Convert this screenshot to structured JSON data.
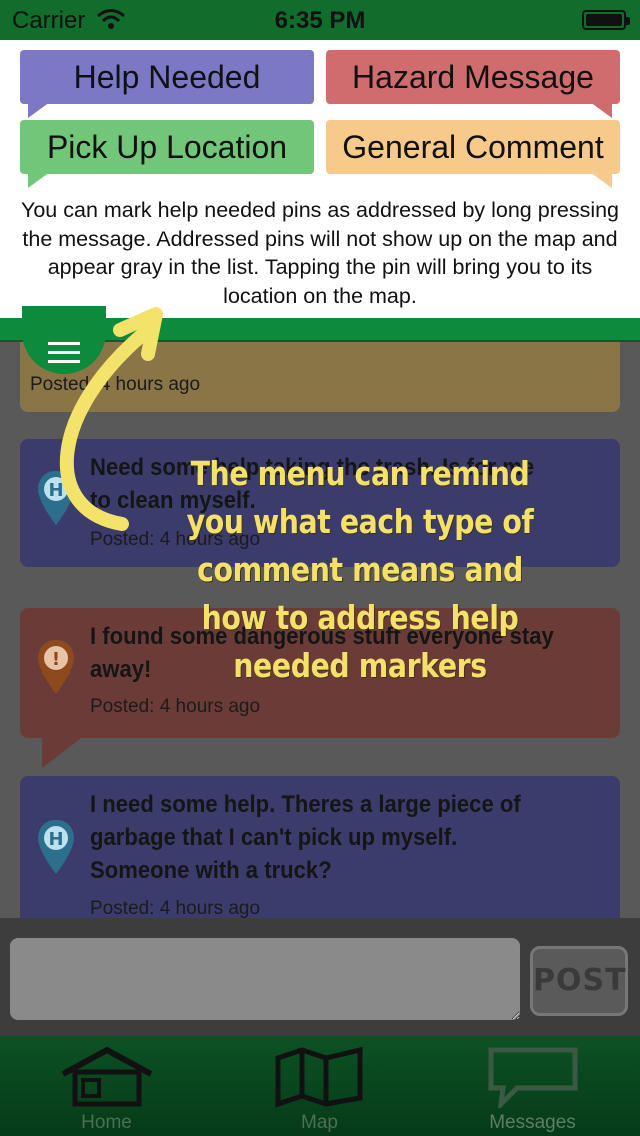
{
  "status_bar": {
    "carrier": "Carrier",
    "time": "6:35 PM"
  },
  "legend": {
    "help_needed": "Help Needed",
    "hazard_message": "Hazard Message",
    "pick_up_location": "Pick Up Location",
    "general_comment": "General Comment",
    "description": "You can mark help needed pins as addressed by long pressing the message. Addressed pins will not show up on the map and appear gray in the list. Tapping the pin will bring you to its location on the map.",
    "colors": {
      "help": "#7b79c6",
      "hazard": "#cf6d6e",
      "pickup": "#72c67a",
      "general": "#f7c98a"
    }
  },
  "messages": [
    {
      "type": "general",
      "text": "",
      "posted": "Posted: 4 hours ago"
    },
    {
      "type": "help",
      "icon": "help-pin-icon",
      "text": "Need some help taking the trash. Is for me to clean myself.",
      "posted": "Posted: 4 hours ago"
    },
    {
      "type": "hazard",
      "icon": "hazard-pin-icon",
      "text": "I found some dangerous stuff everyone stay away!",
      "posted": "Posted: 4 hours ago"
    },
    {
      "type": "help",
      "icon": "help-pin-icon",
      "text": "I need some help. Theres a large piece of garbage that I can't pick up myself. Someone with a truck?",
      "posted": "Posted: 4 hours ago"
    }
  ],
  "composer": {
    "post_label": "POST",
    "placeholder": ""
  },
  "tabs": [
    {
      "label": "Home",
      "icon": "house-icon"
    },
    {
      "label": "Map",
      "icon": "map-icon"
    },
    {
      "label": "Messages",
      "icon": "speech-bubble-icon",
      "active": true
    }
  ],
  "tutorial": {
    "text": "The menu can remind you what each type of comment means and how to address help needed markers"
  }
}
